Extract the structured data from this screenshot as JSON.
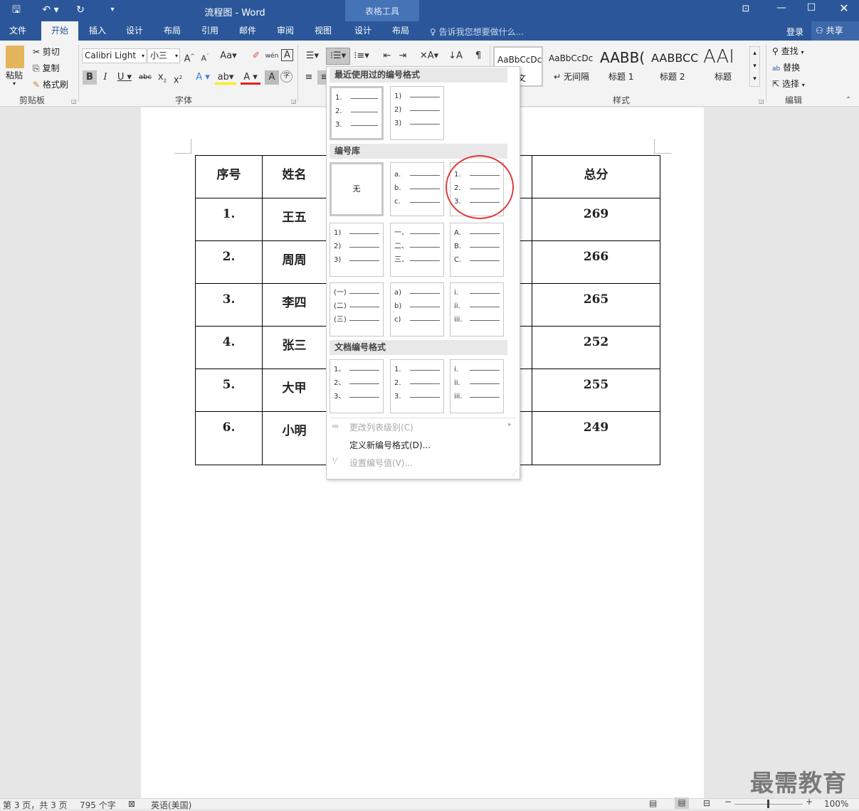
{
  "window": {
    "title": "流程图 - Word",
    "context_tab_group": "表格工具",
    "login": "登录",
    "share": "共享"
  },
  "tabs": [
    "文件",
    "开始",
    "插入",
    "设计",
    "布局",
    "引用",
    "邮件",
    "审阅",
    "视图",
    "设计",
    "布局"
  ],
  "tell_me": "告诉我您想要做什么...",
  "clipboard": {
    "paste": "粘贴",
    "cut": "剪切",
    "copy": "复制",
    "format_painter": "格式刷",
    "group": "剪贴板"
  },
  "font": {
    "name": "Calibri Light",
    "size": "小三",
    "group": "字体"
  },
  "styles": {
    "items": [
      {
        "preview": "AaBbCcDc",
        "label": "正文"
      },
      {
        "preview": "AaBbCcDc",
        "label": "无间隔"
      },
      {
        "preview": "AABB(",
        "label": "标题 1"
      },
      {
        "preview": "AABBCC",
        "label": "标题 2"
      },
      {
        "preview": "AAI",
        "label": "标题"
      }
    ],
    "group": "样式"
  },
  "editing": {
    "find": "查找",
    "replace": "替换",
    "select": "选择",
    "group": "编辑"
  },
  "numbering_menu": {
    "recent_header": "最近使用过的编号格式",
    "library_header": "编号库",
    "doc_header": "文档编号格式",
    "none_label": "无",
    "recent": [
      [
        "1.",
        "2.",
        "3."
      ],
      [
        "1)",
        "2)",
        "3)"
      ]
    ],
    "library": [
      [
        "a.",
        "b.",
        "c."
      ],
      [
        "1.",
        "2.",
        "3."
      ],
      [
        "1)",
        "2)",
        "3)"
      ],
      [
        "一、",
        "二、",
        "三、"
      ],
      [
        "A.",
        "B.",
        "C."
      ],
      [
        "(一)",
        "(二)",
        "(三)"
      ],
      [
        "a)",
        "b)",
        "c)"
      ],
      [
        "i.",
        "ii.",
        "iii."
      ]
    ],
    "document": [
      [
        "1、",
        "2、",
        "3、"
      ],
      [
        "1.",
        "2.",
        "3."
      ],
      [
        "i.",
        "ii.",
        "iii."
      ]
    ],
    "change_level": "更改列表级别(C)",
    "define_new": "定义新编号格式(D)...",
    "set_value": "设置编号值(V)..."
  },
  "table": {
    "headers": [
      "序号",
      "姓名",
      "",
      "总分"
    ],
    "rows": [
      [
        "1.",
        "王五",
        "269"
      ],
      [
        "2.",
        "周周",
        "266"
      ],
      [
        "3.",
        "李四",
        "265"
      ],
      [
        "4.",
        "张三",
        "252"
      ],
      [
        "5.",
        "大甲",
        "255"
      ],
      [
        "6.",
        "小明",
        "249"
      ]
    ]
  },
  "status": {
    "page": "第 3 页，共 3 页",
    "words": "795 个字",
    "language": "英语(美国)",
    "zoom": "100%"
  },
  "watermark": "最需教育",
  "colors": {
    "brand": "#2b579a",
    "highlight_circle": "#e03c3c",
    "context_tab": "#4473b6"
  }
}
